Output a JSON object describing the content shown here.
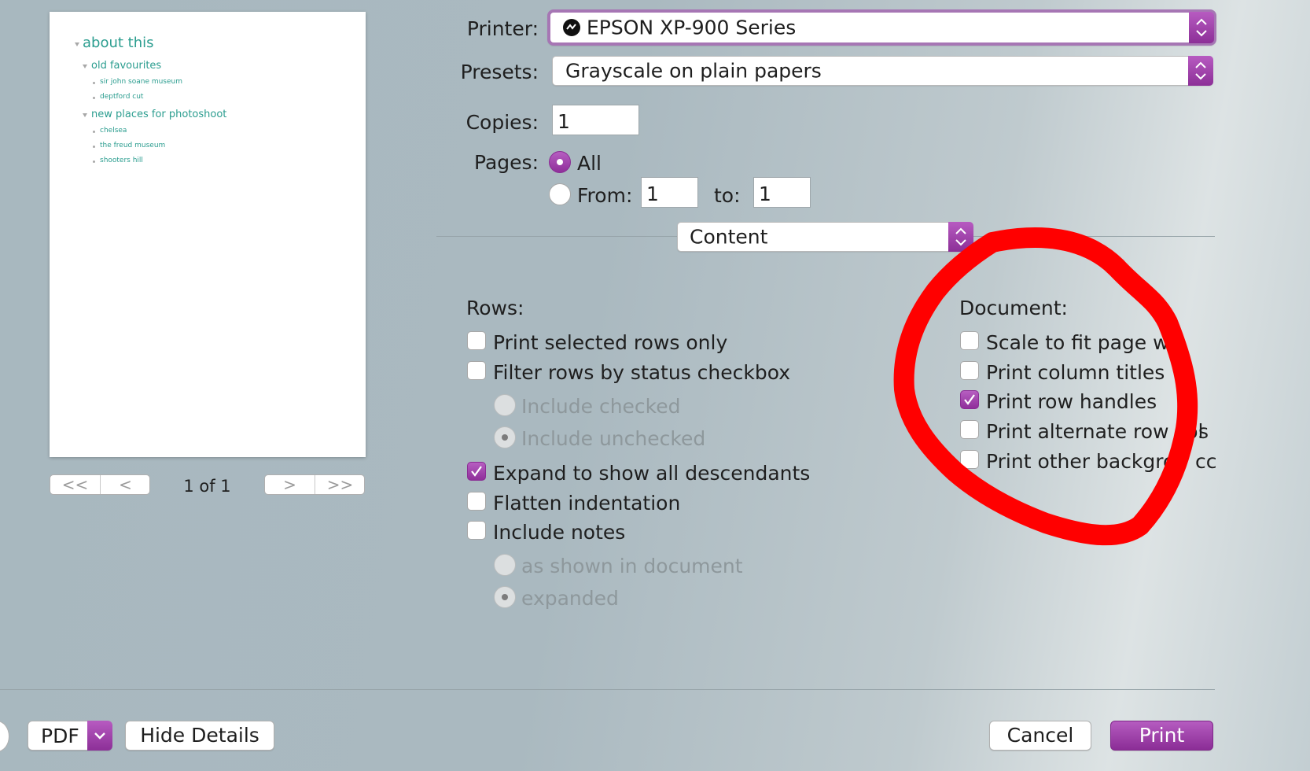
{
  "printer": {
    "label": "Printer:",
    "value": "EPSON XP-900 Series"
  },
  "presets": {
    "label": "Presets:",
    "value": "Grayscale on plain papers"
  },
  "copies": {
    "label": "Copies:",
    "value": "1"
  },
  "pages": {
    "label": "Pages:",
    "all_label": "All",
    "from_label": "From:",
    "from_value": "1",
    "to_label": "to:",
    "to_value": "1",
    "selected": "All"
  },
  "section_select": {
    "value": "Content"
  },
  "rows": {
    "title": "Rows:",
    "print_selected_only": {
      "label": "Print selected rows only",
      "checked": false
    },
    "filter_by_status": {
      "label": "Filter rows by status checkbox",
      "checked": false
    },
    "include_checked": {
      "label": "Include checked",
      "selected": false
    },
    "include_unchecked": {
      "label": "Include unchecked",
      "selected": true
    },
    "expand_descendants": {
      "label": "Expand to show all descendants",
      "checked": true
    },
    "flatten_indentation": {
      "label": "Flatten indentation",
      "checked": false
    },
    "include_notes": {
      "label": "Include notes",
      "checked": false
    },
    "notes_as_shown": {
      "label": "as shown in document",
      "selected": false
    },
    "notes_expanded": {
      "label": "expanded",
      "selected": true
    }
  },
  "document": {
    "title": "Document:",
    "scale_to_fit": {
      "label": "Scale to fit page wi",
      "checked": false
    },
    "print_column_titles": {
      "label": "Print column titles",
      "checked": false
    },
    "print_row_handles": {
      "label": "Print row handles",
      "checked": true
    },
    "print_alternate_row": {
      "label": "Print alternate row col",
      "label_tail": "s",
      "checked": false
    },
    "print_other_background": {
      "label": "Print other backgrou",
      "label_tail": "cc",
      "checked": false
    }
  },
  "preview": {
    "items": [
      {
        "text": "about this",
        "level": 0,
        "expandable": true
      },
      {
        "text": "old favourites",
        "level": 1,
        "expandable": true
      },
      {
        "text": "sir john soane museum",
        "level": 2,
        "expandable": false
      },
      {
        "text": "deptford cut",
        "level": 2,
        "expandable": false
      },
      {
        "text": "new places for photoshoot",
        "level": 1,
        "expandable": true
      },
      {
        "text": "chelsea",
        "level": 2,
        "expandable": false
      },
      {
        "text": "the freud museum",
        "level": 2,
        "expandable": false
      },
      {
        "text": "shooters hill",
        "level": 2,
        "expandable": false
      }
    ],
    "page_indicator": "1 of 1",
    "nav": {
      "first": "<<",
      "prev": "<",
      "next": ">",
      "last": ">>"
    }
  },
  "footer": {
    "pdf_label": "PDF",
    "hide_details_label": "Hide Details",
    "cancel_label": "Cancel",
    "print_label": "Print"
  },
  "colors": {
    "accent": "#9b3fa6",
    "outline_text": "#2b9d8f",
    "annotation": "#ff0000"
  }
}
